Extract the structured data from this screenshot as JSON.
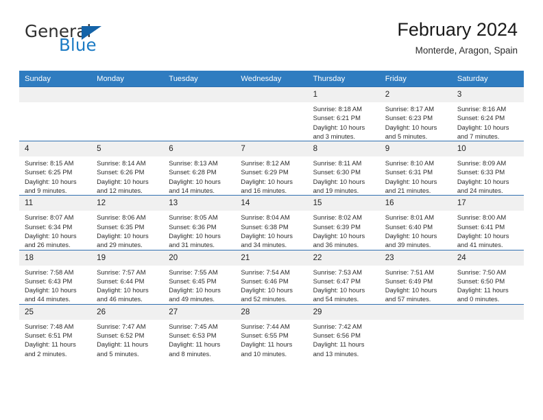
{
  "brand": {
    "name_top": "General",
    "name_bottom": "Blue",
    "triangle_color": "#1463a8",
    "blue_color": "#1c7bc4"
  },
  "header": {
    "title": "February 2024",
    "subtitle": "Monterde, Aragon, Spain"
  },
  "theme": {
    "header_row_bg": "#2f7cc0",
    "row_divider": "#2f6fb0",
    "daynum_bg": "#f0f0f0",
    "text": "#2b2b2b"
  },
  "calendar": {
    "weekday_headers": [
      "Sunday",
      "Monday",
      "Tuesday",
      "Wednesday",
      "Thursday",
      "Friday",
      "Saturday"
    ],
    "weeks": [
      [
        {
          "day": "",
          "sunrise": "",
          "sunset": "",
          "daylight_line1": "",
          "daylight_line2": ""
        },
        {
          "day": "",
          "sunrise": "",
          "sunset": "",
          "daylight_line1": "",
          "daylight_line2": ""
        },
        {
          "day": "",
          "sunrise": "",
          "sunset": "",
          "daylight_line1": "",
          "daylight_line2": ""
        },
        {
          "day": "",
          "sunrise": "",
          "sunset": "",
          "daylight_line1": "",
          "daylight_line2": ""
        },
        {
          "day": "1",
          "sunrise": "Sunrise: 8:18 AM",
          "sunset": "Sunset: 6:21 PM",
          "daylight_line1": "Daylight: 10 hours",
          "daylight_line2": "and 3 minutes."
        },
        {
          "day": "2",
          "sunrise": "Sunrise: 8:17 AM",
          "sunset": "Sunset: 6:23 PM",
          "daylight_line1": "Daylight: 10 hours",
          "daylight_line2": "and 5 minutes."
        },
        {
          "day": "3",
          "sunrise": "Sunrise: 8:16 AM",
          "sunset": "Sunset: 6:24 PM",
          "daylight_line1": "Daylight: 10 hours",
          "daylight_line2": "and 7 minutes."
        }
      ],
      [
        {
          "day": "4",
          "sunrise": "Sunrise: 8:15 AM",
          "sunset": "Sunset: 6:25 PM",
          "daylight_line1": "Daylight: 10 hours",
          "daylight_line2": "and 9 minutes."
        },
        {
          "day": "5",
          "sunrise": "Sunrise: 8:14 AM",
          "sunset": "Sunset: 6:26 PM",
          "daylight_line1": "Daylight: 10 hours",
          "daylight_line2": "and 12 minutes."
        },
        {
          "day": "6",
          "sunrise": "Sunrise: 8:13 AM",
          "sunset": "Sunset: 6:28 PM",
          "daylight_line1": "Daylight: 10 hours",
          "daylight_line2": "and 14 minutes."
        },
        {
          "day": "7",
          "sunrise": "Sunrise: 8:12 AM",
          "sunset": "Sunset: 6:29 PM",
          "daylight_line1": "Daylight: 10 hours",
          "daylight_line2": "and 16 minutes."
        },
        {
          "day": "8",
          "sunrise": "Sunrise: 8:11 AM",
          "sunset": "Sunset: 6:30 PM",
          "daylight_line1": "Daylight: 10 hours",
          "daylight_line2": "and 19 minutes."
        },
        {
          "day": "9",
          "sunrise": "Sunrise: 8:10 AM",
          "sunset": "Sunset: 6:31 PM",
          "daylight_line1": "Daylight: 10 hours",
          "daylight_line2": "and 21 minutes."
        },
        {
          "day": "10",
          "sunrise": "Sunrise: 8:09 AM",
          "sunset": "Sunset: 6:33 PM",
          "daylight_line1": "Daylight: 10 hours",
          "daylight_line2": "and 24 minutes."
        }
      ],
      [
        {
          "day": "11",
          "sunrise": "Sunrise: 8:07 AM",
          "sunset": "Sunset: 6:34 PM",
          "daylight_line1": "Daylight: 10 hours",
          "daylight_line2": "and 26 minutes."
        },
        {
          "day": "12",
          "sunrise": "Sunrise: 8:06 AM",
          "sunset": "Sunset: 6:35 PM",
          "daylight_line1": "Daylight: 10 hours",
          "daylight_line2": "and 29 minutes."
        },
        {
          "day": "13",
          "sunrise": "Sunrise: 8:05 AM",
          "sunset": "Sunset: 6:36 PM",
          "daylight_line1": "Daylight: 10 hours",
          "daylight_line2": "and 31 minutes."
        },
        {
          "day": "14",
          "sunrise": "Sunrise: 8:04 AM",
          "sunset": "Sunset: 6:38 PM",
          "daylight_line1": "Daylight: 10 hours",
          "daylight_line2": "and 34 minutes."
        },
        {
          "day": "15",
          "sunrise": "Sunrise: 8:02 AM",
          "sunset": "Sunset: 6:39 PM",
          "daylight_line1": "Daylight: 10 hours",
          "daylight_line2": "and 36 minutes."
        },
        {
          "day": "16",
          "sunrise": "Sunrise: 8:01 AM",
          "sunset": "Sunset: 6:40 PM",
          "daylight_line1": "Daylight: 10 hours",
          "daylight_line2": "and 39 minutes."
        },
        {
          "day": "17",
          "sunrise": "Sunrise: 8:00 AM",
          "sunset": "Sunset: 6:41 PM",
          "daylight_line1": "Daylight: 10 hours",
          "daylight_line2": "and 41 minutes."
        }
      ],
      [
        {
          "day": "18",
          "sunrise": "Sunrise: 7:58 AM",
          "sunset": "Sunset: 6:43 PM",
          "daylight_line1": "Daylight: 10 hours",
          "daylight_line2": "and 44 minutes."
        },
        {
          "day": "19",
          "sunrise": "Sunrise: 7:57 AM",
          "sunset": "Sunset: 6:44 PM",
          "daylight_line1": "Daylight: 10 hours",
          "daylight_line2": "and 46 minutes."
        },
        {
          "day": "20",
          "sunrise": "Sunrise: 7:55 AM",
          "sunset": "Sunset: 6:45 PM",
          "daylight_line1": "Daylight: 10 hours",
          "daylight_line2": "and 49 minutes."
        },
        {
          "day": "21",
          "sunrise": "Sunrise: 7:54 AM",
          "sunset": "Sunset: 6:46 PM",
          "daylight_line1": "Daylight: 10 hours",
          "daylight_line2": "and 52 minutes."
        },
        {
          "day": "22",
          "sunrise": "Sunrise: 7:53 AM",
          "sunset": "Sunset: 6:47 PM",
          "daylight_line1": "Daylight: 10 hours",
          "daylight_line2": "and 54 minutes."
        },
        {
          "day": "23",
          "sunrise": "Sunrise: 7:51 AM",
          "sunset": "Sunset: 6:49 PM",
          "daylight_line1": "Daylight: 10 hours",
          "daylight_line2": "and 57 minutes."
        },
        {
          "day": "24",
          "sunrise": "Sunrise: 7:50 AM",
          "sunset": "Sunset: 6:50 PM",
          "daylight_line1": "Daylight: 11 hours",
          "daylight_line2": "and 0 minutes."
        }
      ],
      [
        {
          "day": "25",
          "sunrise": "Sunrise: 7:48 AM",
          "sunset": "Sunset: 6:51 PM",
          "daylight_line1": "Daylight: 11 hours",
          "daylight_line2": "and 2 minutes."
        },
        {
          "day": "26",
          "sunrise": "Sunrise: 7:47 AM",
          "sunset": "Sunset: 6:52 PM",
          "daylight_line1": "Daylight: 11 hours",
          "daylight_line2": "and 5 minutes."
        },
        {
          "day": "27",
          "sunrise": "Sunrise: 7:45 AM",
          "sunset": "Sunset: 6:53 PM",
          "daylight_line1": "Daylight: 11 hours",
          "daylight_line2": "and 8 minutes."
        },
        {
          "day": "28",
          "sunrise": "Sunrise: 7:44 AM",
          "sunset": "Sunset: 6:55 PM",
          "daylight_line1": "Daylight: 11 hours",
          "daylight_line2": "and 10 minutes."
        },
        {
          "day": "29",
          "sunrise": "Sunrise: 7:42 AM",
          "sunset": "Sunset: 6:56 PM",
          "daylight_line1": "Daylight: 11 hours",
          "daylight_line2": "and 13 minutes."
        },
        {
          "day": "",
          "sunrise": "",
          "sunset": "",
          "daylight_line1": "",
          "daylight_line2": ""
        },
        {
          "day": "",
          "sunrise": "",
          "sunset": "",
          "daylight_line1": "",
          "daylight_line2": ""
        }
      ]
    ]
  }
}
